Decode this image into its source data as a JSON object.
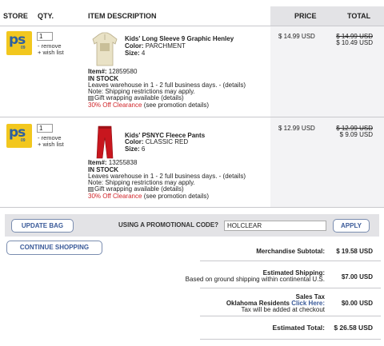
{
  "columns": {
    "store": "STORE",
    "qty": "QTY.",
    "description": "ITEM DESCRIPTION",
    "price": "PRICE",
    "total": "TOTAL"
  },
  "items": [
    {
      "store_logo_text": "ps",
      "store_logo_year": "09",
      "qty": "1",
      "remove_label": "- remove",
      "wishlist_label": "+ wish list",
      "name": "Kids' Long Sleeve 9 Graphic Henley",
      "color_label": "Color:",
      "color": "PARCHMENT",
      "size_label": "Size:",
      "size": "4",
      "item_label": "Item#:",
      "item_no": "12859580",
      "stock": "IN STOCK",
      "shipping": "Leaves warehouse in 1 - 2 full business days. - (details)",
      "note": "Note: Shipping restrictions may apply.",
      "gift": "Gift wrapping available  (details)",
      "promo": "30% Off Clearance",
      "promo_details": "(see promotion details)",
      "price": "$ 14.99 USD",
      "total_old": "$ 14.99  USD",
      "total_new": "$ 10.49  USD",
      "image_color": "#e9e2c6"
    },
    {
      "store_logo_text": "ps",
      "store_logo_year": "09",
      "qty": "1",
      "remove_label": "- remove",
      "wishlist_label": "+ wish list",
      "name": "Kids' PSNYC Fleece Pants",
      "color_label": "Color:",
      "color": "CLASSIC RED",
      "size_label": "Size:",
      "size": "6",
      "item_label": "Item#:",
      "item_no": "13255838",
      "stock": "IN STOCK",
      "shipping": "Leaves warehouse in 1 - 2 full business days. - (details)",
      "note": "Note: Shipping restrictions may apply.",
      "gift": "Gift wrapping available  (details)",
      "promo": "30% Off Clearance",
      "promo_details": "(see promotion details)",
      "price": "$ 12.99 USD",
      "total_old": "$ 12.99  USD",
      "total_new": "$ 9.09  USD",
      "image_color": "#c8161e"
    }
  ],
  "actions": {
    "update_bag": "UPDATE BAG",
    "promo_label": "USING A PROMOTIONAL CODE?",
    "promo_value": "HOLCLEAR",
    "apply": "APPLY",
    "continue_shopping": "CONTINUE SHOPPING"
  },
  "summary": {
    "subtotal_label": "Merchandise Subtotal:",
    "subtotal_value": "$ 19.58 USD",
    "shipping_label": "Estimated Shipping:",
    "shipping_sub": "Based on ground shipping within continental U.S.",
    "shipping_value": "$7.00 USD",
    "tax_title": "Sales Tax",
    "tax_residents": "Oklahoma Residents",
    "tax_click": "Click Here:",
    "tax_note": "Tax will be added at checkout",
    "tax_value": "$0.00 USD",
    "total_label": "Estimated Total:",
    "total_value": "$ 26.58 USD"
  },
  "colors": {
    "promo_red": "#d0252a",
    "link_blue": "#3a5a99",
    "logo_yellow": "#f2c71e",
    "logo_blue": "#2d5fa0"
  }
}
